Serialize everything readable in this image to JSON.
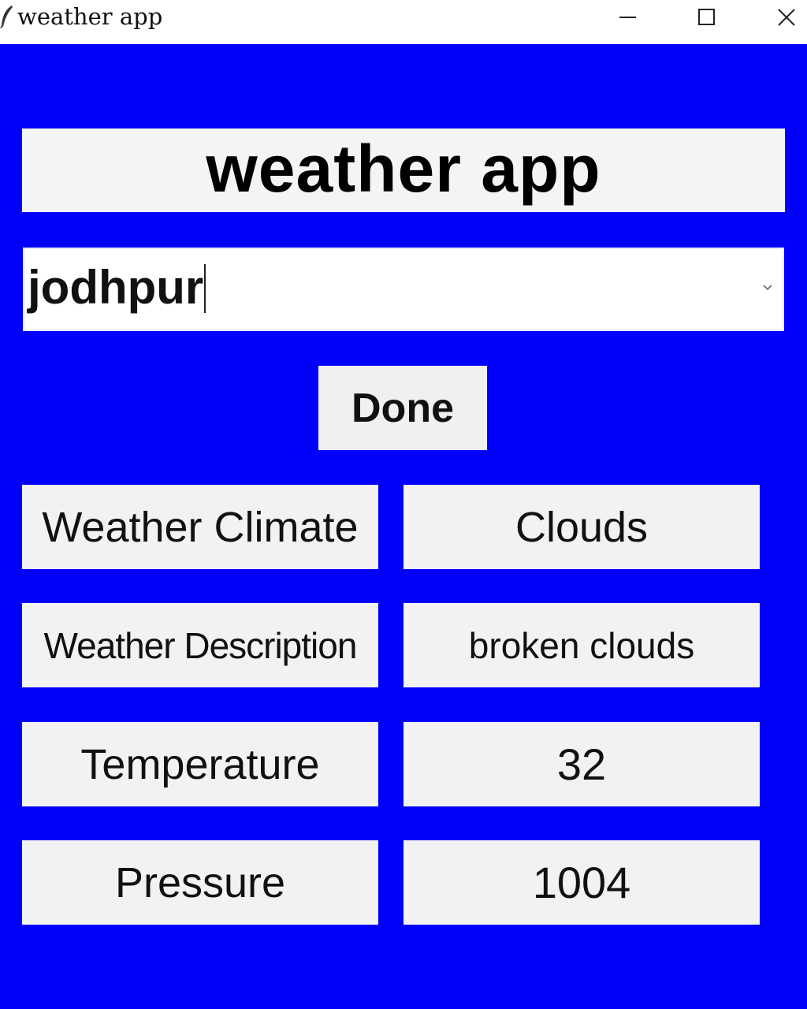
{
  "window": {
    "title": "weather app",
    "icon": "feather-icon",
    "controls": [
      "minimize-icon",
      "maximize-icon",
      "close-icon"
    ]
  },
  "colors": {
    "background": "#0000fb",
    "panel": "#f2f2f2",
    "text": "#111111"
  },
  "header": {
    "title": "weather app"
  },
  "city_combo": {
    "value": "jodhpur"
  },
  "done_button": {
    "label": "Done"
  },
  "rows": [
    {
      "label": "Weather Climate",
      "value": "Clouds"
    },
    {
      "label": "Weather Description",
      "value": "broken clouds"
    },
    {
      "label": "Temperature",
      "value": "32"
    },
    {
      "label": "Pressure",
      "value": "1004"
    }
  ]
}
